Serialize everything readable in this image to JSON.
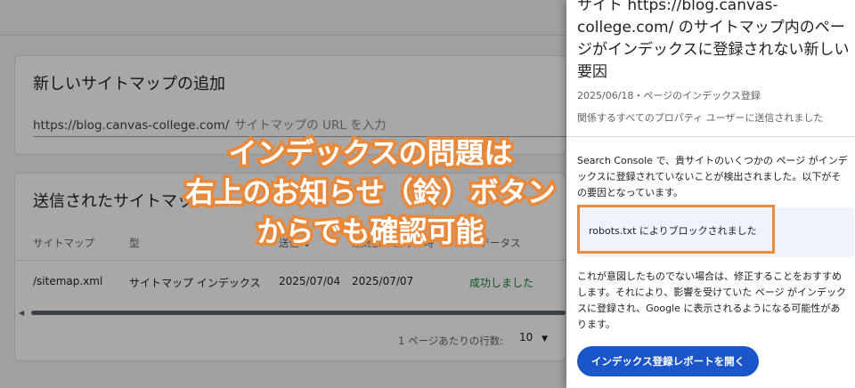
{
  "add_sitemap": {
    "title": "新しいサイトマップの追加",
    "url_prefix": "https://blog.canvas-college.com/",
    "url_placeholder": "サイトマップの URL を入力"
  },
  "sent_sitemaps": {
    "title": "送信されたサイトマップ",
    "columns": [
      "サイトマップ",
      "型",
      "送信 ↓",
      "最終読み込み日時",
      "ステータス"
    ],
    "rows": [
      {
        "sitemap": "/sitemap.xml",
        "type": "サイトマップ インデックス",
        "submitted": "2025/07/04",
        "last_read": "2025/07/07",
        "status": "成功しました"
      }
    ],
    "rows_per_page_label": "1 ページあたりの行数:",
    "rows_per_page_value": "10"
  },
  "caption": {
    "line1": "インデックスの問題は",
    "line2": "右上のお知らせ（鈴）ボタン",
    "line3": "からでも確認可能"
  },
  "notification": {
    "title": "サイト https://blog.canvas-college.com/ のサイトマップ内のページがインデックスに登録されない新しい要因",
    "meta": "2025/06/18・ページのインデックス登録",
    "recipients": "関係するすべてのプロパティ ユーザーに送信されました",
    "body1": "Search Console で、貴サイトのいくつかの ページ がインデックスに登録されていないことが検出されました。以下がその要因となっています。",
    "reason": "robots.txt によりブロックされました",
    "body2": "これが意図したものでない場合は、修正することをおすすめします。それにより、影響を受けていた ページ がインデックスに登録され、Google に表示されるようになる可能性があります。",
    "button_label": "インデックス登録レポートを開く"
  },
  "colors": {
    "accent_orange": "#e8893c",
    "button_blue": "#1a55c9",
    "success_green": "#188038"
  }
}
